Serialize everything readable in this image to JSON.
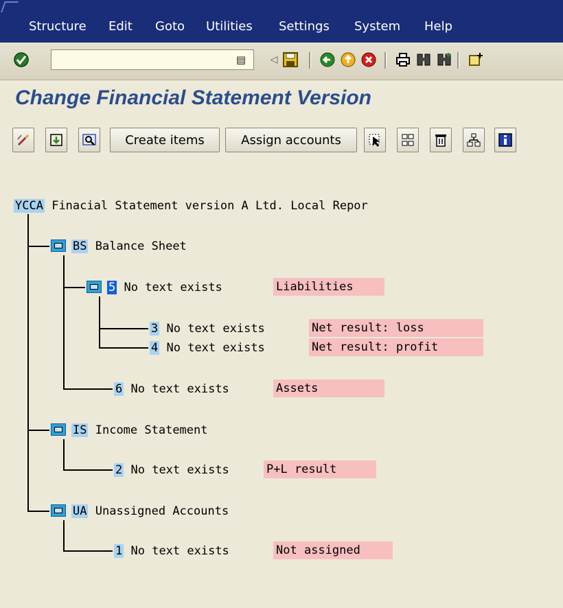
{
  "menubar": {
    "items": [
      {
        "label": "Structure"
      },
      {
        "label": "Edit"
      },
      {
        "label": "Goto"
      },
      {
        "label": "Utilities"
      },
      {
        "label": "Settings"
      },
      {
        "label": "System"
      },
      {
        "label": "Help"
      }
    ]
  },
  "std_toolbar": {
    "command_field_value": "",
    "icons": [
      "enter-icon",
      "save-icon",
      "back-icon",
      "exit-icon",
      "cancel-icon",
      "print-icon",
      "find-icon",
      "find-next-icon",
      "new-session-icon"
    ]
  },
  "page_title": "Change Financial Statement Version",
  "app_toolbar": {
    "create_items_label": "Create items",
    "assign_accounts_label": "Assign accounts"
  },
  "tree": {
    "root": {
      "key": "YCCA",
      "text": "Finacial Statement version A Ltd. Local Repor"
    },
    "bs": {
      "key": "BS",
      "text": "Balance Sheet"
    },
    "n5": {
      "key": "5",
      "text": "No text exists",
      "desc": "Liabilities"
    },
    "n3": {
      "key": "3",
      "text": "No text exists",
      "desc": "Net result: loss"
    },
    "n4": {
      "key": "4",
      "text": "No text exists",
      "desc": "Net result: profit"
    },
    "n6": {
      "key": "6",
      "text": "No text exists",
      "desc": "Assets"
    },
    "is": {
      "key": "IS",
      "text": "Income Statement"
    },
    "n2": {
      "key": "2",
      "text": "No text exists",
      "desc": "P+L result"
    },
    "ua": {
      "key": "UA",
      "text": "Unassigned Accounts"
    },
    "n1": {
      "key": "1",
      "text": "No text exists",
      "desc": "Not assigned"
    }
  },
  "colors": {
    "menubar_bg": "#1a2d78",
    "title_text": "#2b4d8c",
    "key_highlight": "#a9d2f2",
    "selected_key": "#1460d8",
    "desc_highlight": "#f7bfc0"
  }
}
